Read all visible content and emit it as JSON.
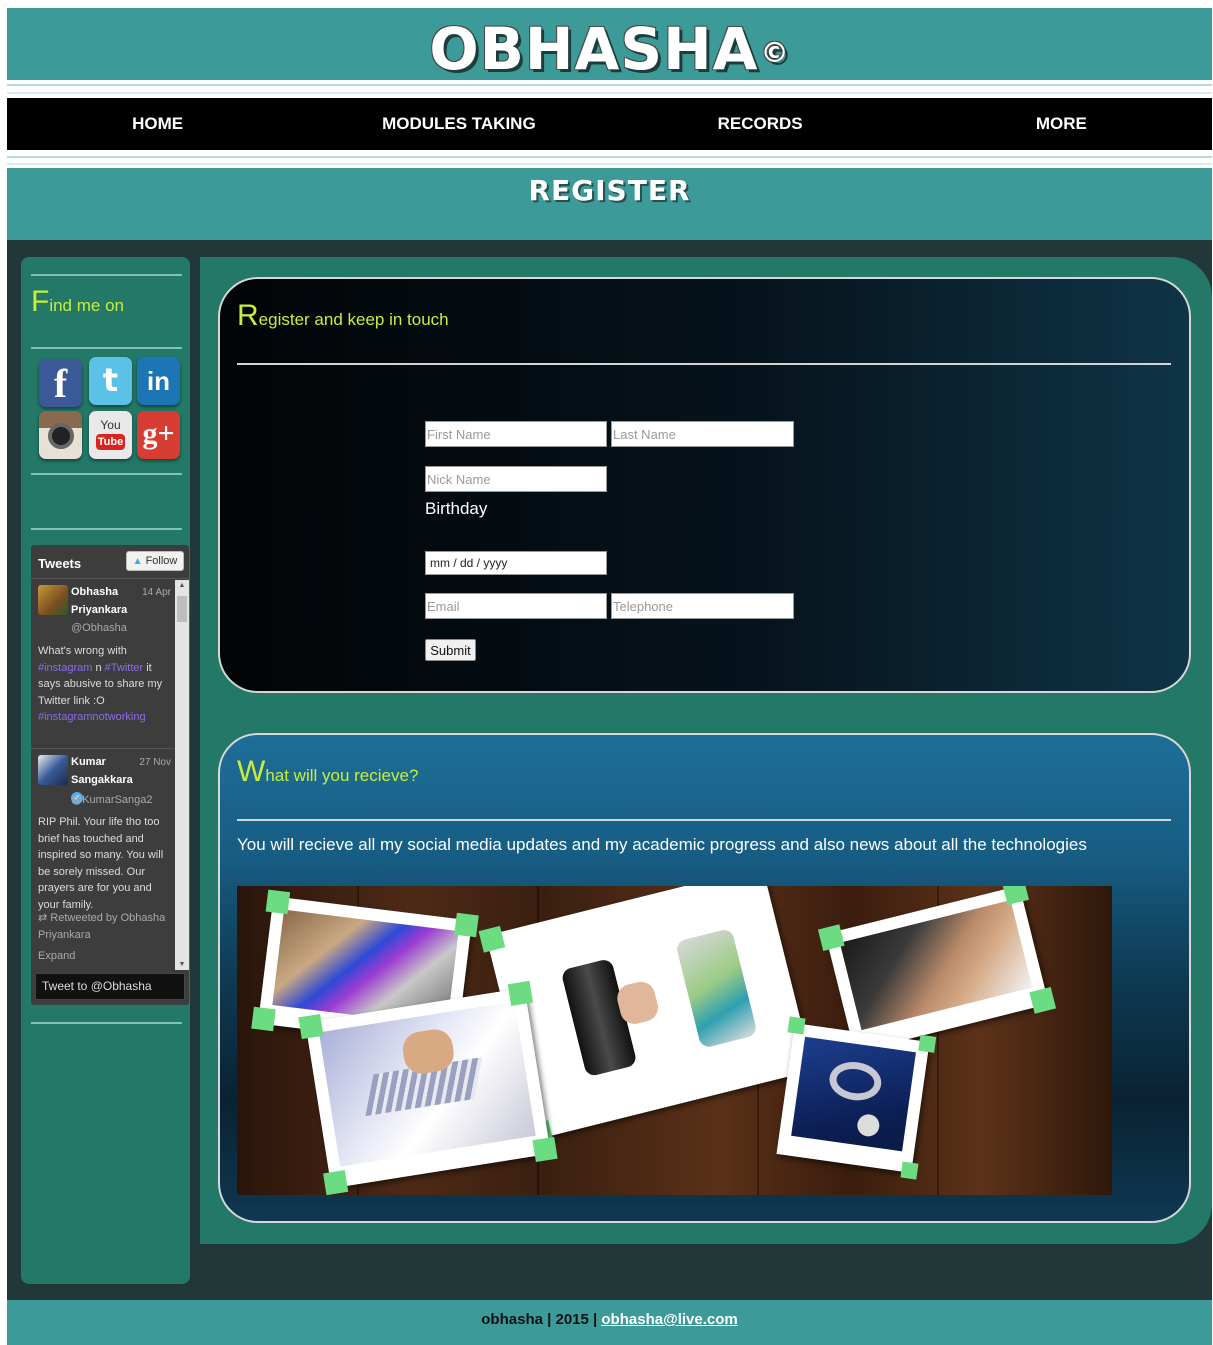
{
  "header": {
    "logo": "OBHASHA",
    "logo_mark": "©"
  },
  "nav": {
    "items": [
      "HOME",
      "MODULES TAKING",
      "RECORDS",
      "MORE"
    ]
  },
  "page": {
    "title": "REGISTER"
  },
  "sidebar": {
    "find_title_initial": "F",
    "find_title_rest": "ind me on",
    "social": [
      {
        "icon": "facebook-icon",
        "glyph": "f",
        "color": "#3b5998"
      },
      {
        "icon": "twitter-icon",
        "glyph": "t",
        "color": "#4bb0d8"
      },
      {
        "icon": "linkedin-icon",
        "glyph": "in",
        "color": "#1c75b5"
      },
      {
        "icon": "instagram-icon",
        "glyph": "◉",
        "color": "#7a5a43"
      },
      {
        "icon": "youtube-icon",
        "glyph": "You Tube",
        "color": "#d6d6d6"
      },
      {
        "icon": "googleplus-icon",
        "glyph": "g+",
        "color": "#d73d32"
      }
    ],
    "twitter": {
      "title": "Tweets",
      "follow_label": "Follow",
      "tweets": [
        {
          "name": "Obhasha Priyankara",
          "date": "14 Apr",
          "handle": "@Obhasha",
          "text_parts": [
            "What's wrong with ",
            "#instagram",
            " n ",
            "#Twitter",
            " it says abusive to share my Twitter link :O ",
            "#instagramnotworking"
          ]
        },
        {
          "name": "Kumar Sangakkara",
          "date": "27 Nov",
          "handle": "@KumarSanga2",
          "text": "RIP Phil. Your life tho too brief has touched and inspired so many. You will be sorely missed. Our prayers are for you and your family.",
          "retweet": "Retweeted by Obhasha Priyankara",
          "expand": "Expand"
        }
      ],
      "footer_label": "Tweet to @Obhasha"
    }
  },
  "register": {
    "title_initial": "R",
    "title_rest": "egister and keep in touch",
    "first_name_placeholder": "First Name",
    "last_name_placeholder": "Last Name",
    "nick_name_placeholder": "Nick Name",
    "birthday_label": "Birthday",
    "date_placeholder": "mm / dd / yyyy",
    "email_placeholder": "Email",
    "telephone_placeholder": "Telephone",
    "submit_label": "Submit"
  },
  "info": {
    "title_initial": "W",
    "title_rest": "hat will you recieve?",
    "text": "You will recieve all my social media updates and my academic progress and also news about all the technologies"
  },
  "footer": {
    "text": "obhasha | 2015 | ",
    "email": "obhasha@live.com"
  },
  "colors": {
    "teal": "#3c9a98",
    "green": "#237867",
    "accent": "#c8ee3a",
    "dark": "#223838"
  }
}
